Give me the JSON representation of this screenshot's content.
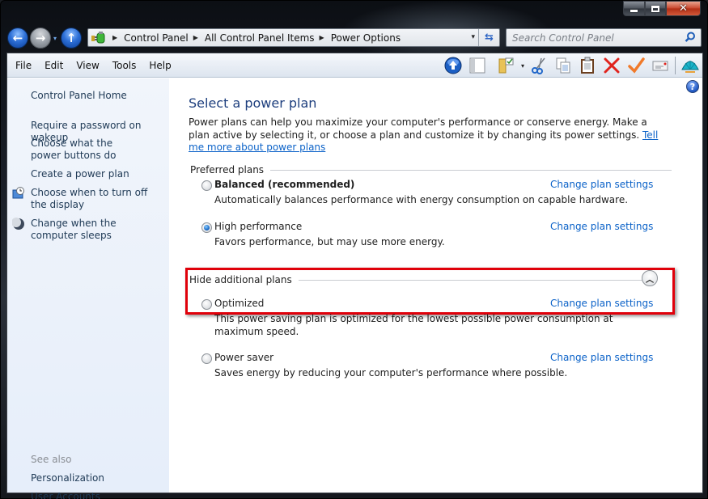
{
  "window": {
    "caption_buttons": {
      "minimize": "minimize",
      "maximize": "maximize",
      "close": "✕"
    }
  },
  "nav": {
    "back_icon": "arrow-left-icon",
    "forward_icon": "arrow-right-icon",
    "up_icon": "arrow-up-icon",
    "back_glyph": "←",
    "forward_glyph": "→",
    "up_glyph": "↑",
    "dropdown_glyph": "▾"
  },
  "address": {
    "breadcrumbs": [
      "Control Panel",
      "All Control Panel Items",
      "Power Options"
    ],
    "separator_glyph": "▶",
    "dropdown_glyph": "▾",
    "refresh_glyph": "⇆"
  },
  "search": {
    "placeholder": "Search Control Panel"
  },
  "menu": {
    "items": [
      "File",
      "Edit",
      "View",
      "Tools",
      "Help"
    ]
  },
  "toolbar": {
    "buttons": [
      "up",
      "preview-pane",
      "folder-options",
      "cut",
      "copy",
      "paste",
      "delete",
      "apply",
      "properties",
      "shell"
    ]
  },
  "left_pane": {
    "home_link": "Control Panel Home",
    "tasks": [
      "Require a password on wakeup",
      "Choose what the power buttons do",
      "Create a power plan",
      "Choose when to turn off the display",
      "Change when the computer sleeps"
    ],
    "see_also_label": "See also",
    "see_also": [
      "Personalization",
      "User Accounts"
    ]
  },
  "content": {
    "help_glyph": "?",
    "title": "Select a power plan",
    "intro_text": "Power plans can help you maximize your computer's performance or conserve energy. Make a plan active by selecting it, or choose a plan and customize it by changing its power settings. ",
    "intro_link": "Tell me more about power plans",
    "preferred_header": "Preferred plans",
    "additional_header": "Hide additional plans",
    "collapse_glyph": "︿",
    "change_link": "Change plan settings",
    "plans": [
      {
        "name": "Balanced (recommended)",
        "description": "Automatically balances performance with energy consumption on capable hardware.",
        "selected": false
      },
      {
        "name": "High performance",
        "description": "Favors performance, but may use more energy.",
        "selected": true
      },
      {
        "name": "Optimized",
        "description": "This power saving plan is optimized for the lowest possible power consumption at maximum speed.",
        "selected": false
      },
      {
        "name": "Power saver",
        "description": "Saves energy by reducing your computer's performance where possible.",
        "selected": false
      }
    ],
    "highlight_color": "#e0000a"
  }
}
